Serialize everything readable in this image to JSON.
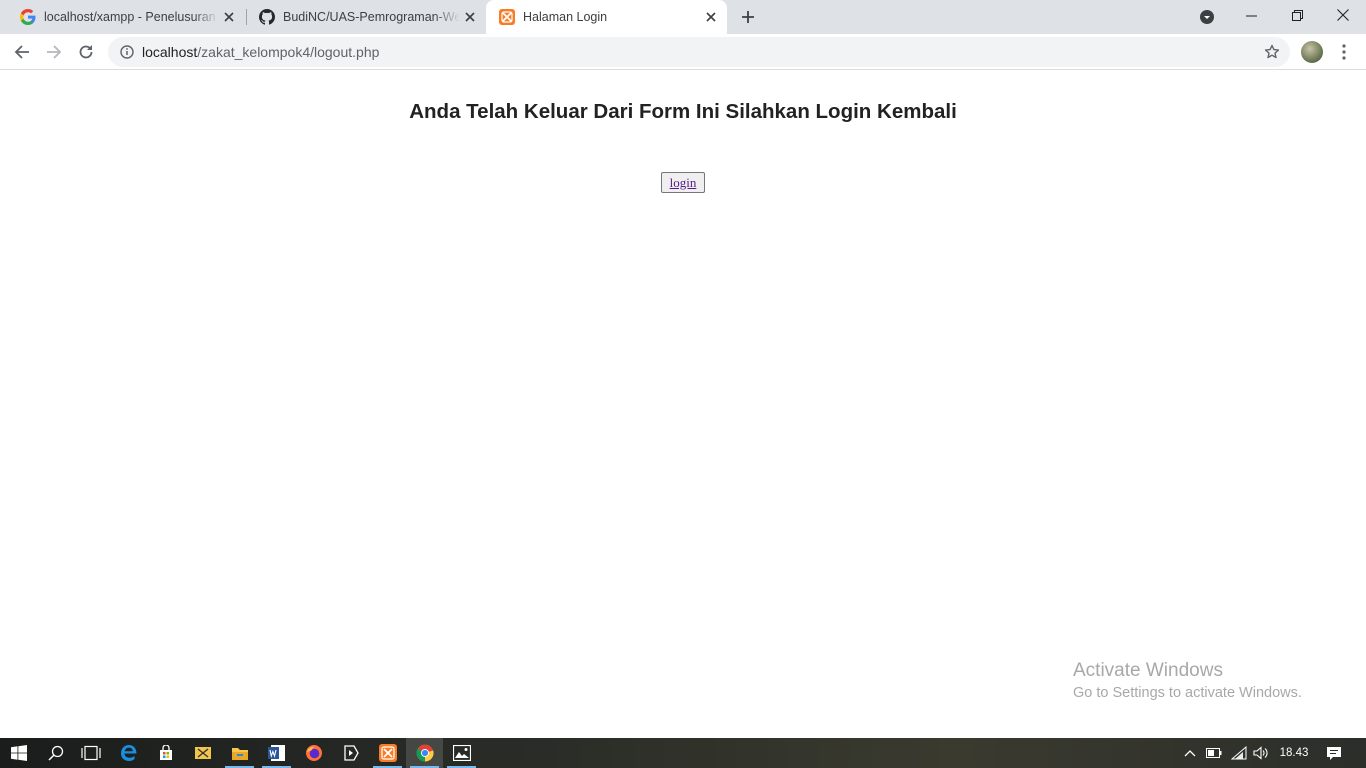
{
  "browser": {
    "tabs": [
      {
        "title": "localhost/xampp - Penelusuran Google",
        "favicon": "google-g-icon",
        "active": false
      },
      {
        "title": "BudiNC/UAS-Pemrograman-Web",
        "favicon": "github-icon",
        "active": false
      },
      {
        "title": "Halaman Login",
        "favicon": "xampp-icon",
        "active": true
      }
    ],
    "url_host": "localhost",
    "url_path": "/zakat_kelompok4/logout.php"
  },
  "page": {
    "heading": "Anda Telah Keluar Dari Form Ini Silahkan Login Kembali",
    "login_link": "login"
  },
  "watermark": {
    "line1": "Activate Windows",
    "line2": "Go to Settings to activate Windows."
  },
  "taskbar": {
    "clock": "18.43",
    "apps": [
      "start-icon",
      "search-icon",
      "task-view-icon",
      "edge-icon",
      "store-icon",
      "snipping-icon",
      "file-explorer-icon",
      "word-icon",
      "firefox-icon",
      "media-icon",
      "xampp-icon",
      "chrome-icon",
      "photos-icon"
    ]
  },
  "colors": {
    "tabstrip": "#dee1e6",
    "omnibox": "#f1f3f4",
    "link": "#551a8b",
    "xampp_orange": "#fb7a24"
  }
}
